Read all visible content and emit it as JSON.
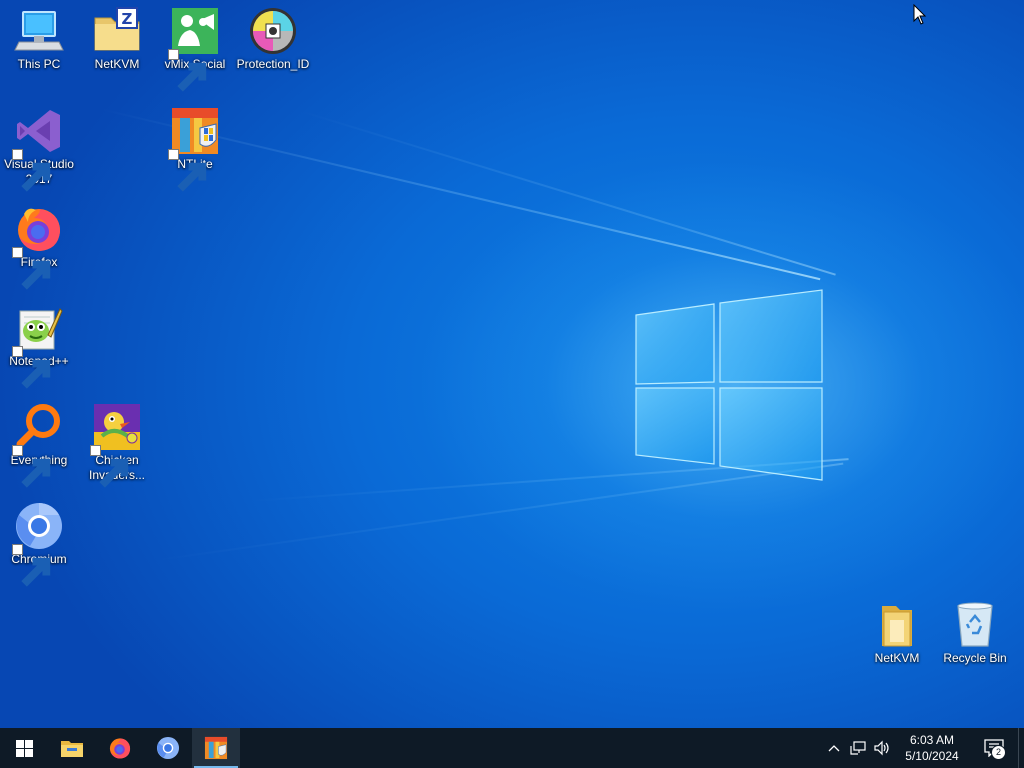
{
  "desktop": {
    "icons": [
      {
        "id": "this-pc",
        "label": "This PC",
        "icon": "computer-icon"
      },
      {
        "id": "netkvm-top",
        "label": "NetKVM",
        "icon": "zip-folder-icon"
      },
      {
        "id": "vmix-social",
        "label": "vMix Social",
        "icon": "vmix-icon"
      },
      {
        "id": "protection-id",
        "label": "Protection_ID",
        "icon": "disc-icon"
      },
      {
        "id": "visual-studio",
        "label": "Visual Studio\n2017",
        "icon": "visual-studio-icon"
      },
      {
        "id": "ntlite",
        "label": "NTLite",
        "icon": "ntlite-icon"
      },
      {
        "id": "firefox",
        "label": "Firefox",
        "icon": "firefox-icon"
      },
      {
        "id": "notepadpp",
        "label": "Notepad++",
        "icon": "notepadpp-icon"
      },
      {
        "id": "everything",
        "label": "Everything",
        "icon": "everything-icon"
      },
      {
        "id": "chicken-invaders",
        "label": "Chicken\nInvaders...",
        "icon": "chicken-invaders-icon"
      },
      {
        "id": "chromium",
        "label": "Chromium",
        "icon": "chromium-icon"
      },
      {
        "id": "netkvm-bottom",
        "label": "NetKVM",
        "icon": "folder-icon"
      },
      {
        "id": "recycle-bin",
        "label": "Recycle Bin",
        "icon": "recycle-bin-icon"
      }
    ]
  },
  "taskbar": {
    "pinned": [
      {
        "name": "start",
        "icon": "windows-start-icon"
      },
      {
        "name": "file-explorer",
        "icon": "file-explorer-icon"
      },
      {
        "name": "firefox",
        "icon": "firefox-icon"
      },
      {
        "name": "chromium",
        "icon": "chromium-icon"
      },
      {
        "name": "ntlite",
        "icon": "ntlite-icon",
        "active": true
      }
    ],
    "tray": {
      "time": "6:03 AM",
      "date": "5/10/2024",
      "notification_count": "2"
    }
  },
  "colors": {
    "taskbar": "#0e1a26",
    "active_indicator": "#76b9ed",
    "wallpaper_primary": "#0a6ad6"
  }
}
